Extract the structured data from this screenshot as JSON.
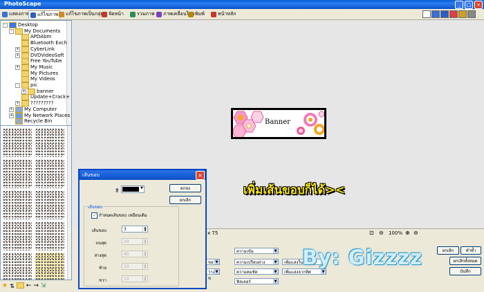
{
  "app": {
    "title": "PhotoScape"
  },
  "tabs": [
    {
      "label": "แสดงภาพ",
      "color": "#3a6fd8"
    },
    {
      "label": "แก้ไขภาพ",
      "color": "#2a5fc4"
    },
    {
      "label": "แก้ไขภาพเป็นกลุ่ม",
      "color": "#d08a22"
    },
    {
      "label": "จัดหน้า",
      "color": "#c0392b"
    },
    {
      "label": "รวมภาพ",
      "color": "#2e8b57"
    },
    {
      "label": "ภาพเคลื่อนไหว",
      "color": "#7b3fbf"
    },
    {
      "label": "พิมพ์",
      "color": "#b8860b"
    },
    {
      "label": "หน้าหลัก",
      "color": "#c0392b"
    }
  ],
  "tree": [
    {
      "label": "Desktop",
      "indent": 0,
      "expander": "-",
      "icon": "desktop"
    },
    {
      "label": "My Documents",
      "indent": 1,
      "expander": "-",
      "icon": "folder"
    },
    {
      "label": "APDAbm",
      "indent": 2,
      "expander": "",
      "icon": "folder"
    },
    {
      "label": "Bluetooth Exch",
      "indent": 2,
      "expander": "",
      "icon": "folder"
    },
    {
      "label": "CyberLink",
      "indent": 2,
      "expander": "+",
      "icon": "folder"
    },
    {
      "label": "DVDVideoSoft",
      "indent": 2,
      "expander": "+",
      "icon": "folder"
    },
    {
      "label": "Free YouTube",
      "indent": 2,
      "expander": "",
      "icon": "folder"
    },
    {
      "label": "My Music",
      "indent": 2,
      "expander": "+",
      "icon": "music"
    },
    {
      "label": "My Pictures",
      "indent": 2,
      "expander": "",
      "icon": "pictures"
    },
    {
      "label": "My Videos",
      "indent": 2,
      "expander": "",
      "icon": "videos"
    },
    {
      "label": "pic",
      "indent": 2,
      "expander": "-",
      "icon": "folder"
    },
    {
      "label": "banner",
      "indent": 3,
      "expander": "+",
      "icon": "folder"
    },
    {
      "label": "Update+Crack+",
      "indent": 2,
      "expander": "",
      "icon": "folder"
    },
    {
      "label": "?????????",
      "indent": 2,
      "expander": "+",
      "icon": "folder"
    },
    {
      "label": "My Computer",
      "indent": 1,
      "expander": "+",
      "icon": "computer"
    },
    {
      "label": "My Network Places",
      "indent": 1,
      "expander": "+",
      "icon": "network"
    },
    {
      "label": "Recycle Bin",
      "indent": 1,
      "expander": "",
      "icon": "recycle"
    }
  ],
  "canvas": {
    "banner_text": "Banner",
    "caption": "เพิ่มเส้นขอบก็ได้><",
    "watermark": "By: Gizzzz"
  },
  "status": {
    "size_text": "x 75",
    "zoom": "100%"
  },
  "bottom_panel": {
    "dropdowns": [
      "ความเข้ม",
      "ความเปรียบต่าง",
      "ความคมชัด",
      "ฟิลเตอร์",
      "เพิ่มแสงในภาพ",
      "เพิ่มแสงจากทิศ",
      "ขยาย",
      "ว่าง , ข"
    ],
    "buttons": [
      "ยกเลิก",
      "ทำซ้ำ",
      "ยกเลิกทั้งหมด",
      "บันทึก"
    ]
  },
  "dialog": {
    "title": "เส้นขอบ",
    "color_label": "สี",
    "color_value": "#000000",
    "ok": "ตกลง",
    "cancel": "ยกเลิก",
    "group_label": "เส้นขอบ",
    "checkbox_label": "กำหนดเส้นขอบ เหมือนเดิม",
    "checked": true,
    "fields": [
      {
        "label": "เส้นขอบ",
        "value": "3",
        "enabled": true
      },
      {
        "label": "บนสุด",
        "value": "20",
        "enabled": false
      },
      {
        "label": "ล่างสุด",
        "value": "40",
        "enabled": false
      },
      {
        "label": "ซ้าย",
        "value": "10",
        "enabled": false
      },
      {
        "label": "ขวา",
        "value": "10",
        "enabled": false
      }
    ]
  }
}
